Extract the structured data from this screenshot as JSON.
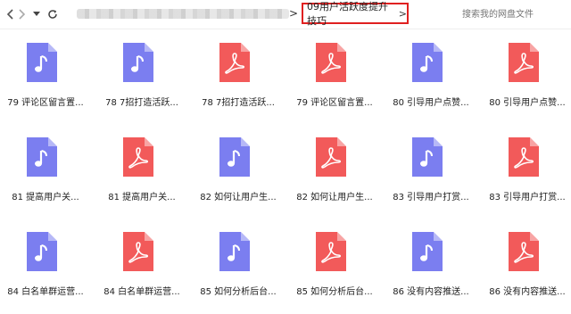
{
  "toolbar": {
    "back_icon": "chevron-left-icon",
    "forward_icon": "chevron-right-icon",
    "dropdown_icon": "caret-down-icon",
    "refresh_icon": "refresh-icon",
    "separator": ">",
    "current_folder": "09用户活跃度提升技巧",
    "current_arrow": ">",
    "search_placeholder": "搜索我的网盘文件"
  },
  "colors": {
    "audio": "#7b7ef0",
    "pdf": "#f25a5a",
    "highlight": "#e02020"
  },
  "files": [
    {
      "label": "79 评论区留言置...",
      "type": "audio"
    },
    {
      "label": "78 7招打造活跃...",
      "type": "audio"
    },
    {
      "label": "78 7招打造活跃...",
      "type": "pdf"
    },
    {
      "label": "79 评论区留言置...",
      "type": "pdf"
    },
    {
      "label": "80 引导用户点赞...",
      "type": "audio"
    },
    {
      "label": "80 引导用户点赞...",
      "type": "pdf"
    },
    {
      "label": "81 提高用户关...",
      "type": "audio"
    },
    {
      "label": "81 提高用户关...",
      "type": "pdf"
    },
    {
      "label": "82 如何让用户生...",
      "type": "audio"
    },
    {
      "label": "82 如何让用户生...",
      "type": "pdf"
    },
    {
      "label": "83 引导用户打赏...",
      "type": "audio"
    },
    {
      "label": "83 引导用户打赏...",
      "type": "pdf"
    },
    {
      "label": "84 白名单群运营...",
      "type": "audio"
    },
    {
      "label": "84 白名单群运营...",
      "type": "pdf"
    },
    {
      "label": "85 如何分析后台...",
      "type": "audio"
    },
    {
      "label": "85 如何分析后台...",
      "type": "pdf"
    },
    {
      "label": "86 没有内容推送...",
      "type": "audio"
    },
    {
      "label": "86 没有内容推送...",
      "type": "pdf"
    }
  ]
}
